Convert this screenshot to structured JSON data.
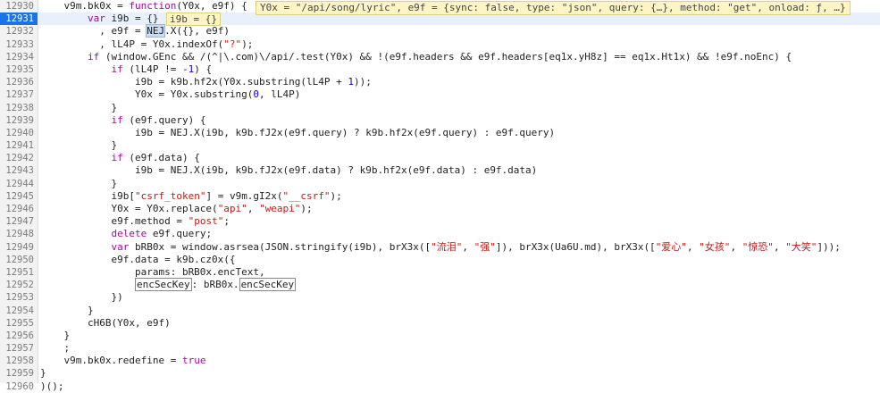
{
  "editor": {
    "inline_hints": {
      "line_12930": "Y0x = \"/api/song/lyric\", e9f = {sync: false, type: \"json\", query: {…}, method: \"get\", onload: ƒ, …}",
      "line_12931": "i9b = {}"
    },
    "lines": [
      {
        "num": "12930",
        "text": "    v9m.bk0x = function(Y0x, e9f) {"
      },
      {
        "num": "12931",
        "text": "        var i9b = {}"
      },
      {
        "num": "12932",
        "text": "          , e9f = NEJ.X({}, e9f)"
      },
      {
        "num": "12933",
        "text": "          , lL4P = Y0x.indexOf(\"?\");"
      },
      {
        "num": "12934",
        "text": "        if (window.GEnc && /(^|\\.com)\\/api/.test(Y0x) && !(e9f.headers && e9f.headers[eq1x.yH8z] == eq1x.Ht1x) && !e9f.noEnc) {"
      },
      {
        "num": "12935",
        "text": "            if (lL4P != -1) {"
      },
      {
        "num": "12936",
        "text": "                i9b = k9b.hf2x(Y0x.substring(lL4P + 1));"
      },
      {
        "num": "12937",
        "text": "                Y0x = Y0x.substring(0, lL4P)"
      },
      {
        "num": "12938",
        "text": "            }"
      },
      {
        "num": "12939",
        "text": "            if (e9f.query) {"
      },
      {
        "num": "12940",
        "text": "                i9b = NEJ.X(i9b, k9b.fJ2x(e9f.query) ? k9b.hf2x(e9f.query) : e9f.query)"
      },
      {
        "num": "12941",
        "text": "            }"
      },
      {
        "num": "12942",
        "text": "            if (e9f.data) {"
      },
      {
        "num": "12943",
        "text": "                i9b = NEJ.X(i9b, k9b.fJ2x(e9f.data) ? k9b.hf2x(e9f.data) : e9f.data)"
      },
      {
        "num": "12944",
        "text": "            }"
      },
      {
        "num": "12945",
        "text": "            i9b[\"csrf_token\"] = v9m.gI2x(\"__csrf\");"
      },
      {
        "num": "12946",
        "text": "            Y0x = Y0x.replace(\"api\", \"weapi\");"
      },
      {
        "num": "12947",
        "text": "            e9f.method = \"post\";"
      },
      {
        "num": "12948",
        "text": "            delete e9f.query;"
      },
      {
        "num": "12949",
        "text": "            var bRB0x = window.asrsea(JSON.stringify(i9b), brX3x([\"流泪\", \"强\"]), brX3x(Ua6U.md), brX3x([\"爱心\", \"女孩\", \"惊恐\", \"大笑\"]));"
      },
      {
        "num": "12950",
        "text": "            e9f.data = k9b.cz0x({"
      },
      {
        "num": "12951",
        "text": "                params: bRB0x.encText,"
      },
      {
        "num": "12952",
        "text": "                encSecKey: bRB0x.encSecKey"
      },
      {
        "num": "12953",
        "text": "            })"
      },
      {
        "num": "12954",
        "text": "        }"
      },
      {
        "num": "12955",
        "text": "        cH6B(Y0x, e9f)"
      },
      {
        "num": "12956",
        "text": "    }"
      },
      {
        "num": "12957",
        "text": "    ;"
      },
      {
        "num": "12958",
        "text": "    v9m.bk0x.redefine = true"
      },
      {
        "num": "12959",
        "text": "}"
      },
      {
        "num": "12960",
        "text": ")();"
      }
    ]
  }
}
